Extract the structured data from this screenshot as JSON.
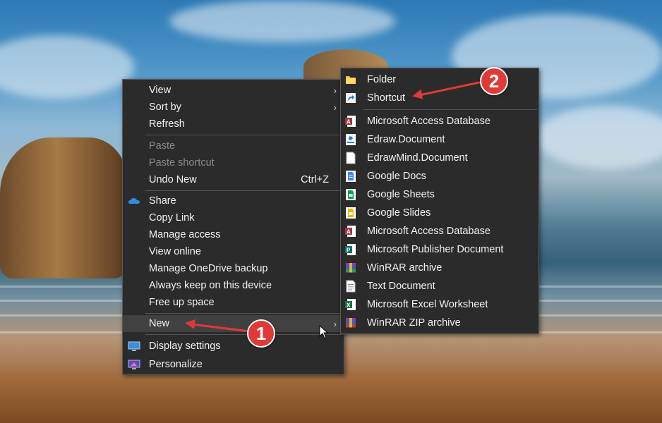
{
  "main_menu": {
    "items": [
      {
        "label": "View",
        "submenu": true
      },
      {
        "label": "Sort by",
        "submenu": true
      },
      {
        "label": "Refresh"
      },
      {
        "label": "Paste",
        "disabled": true
      },
      {
        "label": "Paste shortcut",
        "disabled": true
      },
      {
        "label": "Undo New",
        "shortcut": "Ctrl+Z"
      },
      {
        "label": "Share",
        "icon": "onedrive-icon"
      },
      {
        "label": "Copy Link"
      },
      {
        "label": "Manage access"
      },
      {
        "label": "View online"
      },
      {
        "label": "Manage OneDrive backup"
      },
      {
        "label": "Always keep on this device"
      },
      {
        "label": "Free up space"
      },
      {
        "label": "New",
        "submenu": true,
        "highlighted": true
      },
      {
        "label": "Display settings",
        "icon": "display-settings-icon"
      },
      {
        "label": "Personalize",
        "icon": "personalize-icon"
      }
    ]
  },
  "new_submenu": {
    "items": [
      {
        "label": "Folder",
        "icon": "folder-icon"
      },
      {
        "label": "Shortcut",
        "icon": "shortcut-icon"
      },
      {
        "label": "Microsoft Access Database",
        "icon": "access-icon"
      },
      {
        "label": "Edraw.Document",
        "icon": "edraw-icon"
      },
      {
        "label": "EdrawMind.Document",
        "icon": "blank-document-icon"
      },
      {
        "label": "Google Docs",
        "icon": "google-docs-icon"
      },
      {
        "label": "Google Sheets",
        "icon": "google-sheets-icon"
      },
      {
        "label": "Google Slides",
        "icon": "google-slides-icon"
      },
      {
        "label": "Microsoft Access Database",
        "icon": "access-icon"
      },
      {
        "label": "Microsoft Publisher Document",
        "icon": "publisher-icon"
      },
      {
        "label": "WinRAR archive",
        "icon": "winrar-icon"
      },
      {
        "label": "Text Document",
        "icon": "text-document-icon"
      },
      {
        "label": "Microsoft Excel Worksheet",
        "icon": "excel-icon"
      },
      {
        "label": "WinRAR ZIP archive",
        "icon": "winrar-zip-icon"
      }
    ]
  },
  "callouts": {
    "first": "1",
    "second": "2"
  },
  "colors": {
    "menu_bg": "#2b2b2b",
    "callout": "#e03a36",
    "hover": "#414141"
  }
}
